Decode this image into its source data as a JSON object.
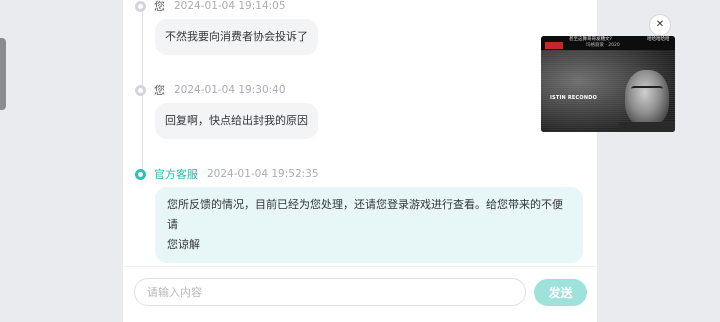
{
  "messages": [
    {
      "sender": "您",
      "time": "2024-01-04 19:14:05",
      "text": "不然我要向消费者协会投诉了"
    },
    {
      "sender": "您",
      "time": "2024-01-04 19:30:40",
      "text": "回复啊，快点给出封我的原因"
    },
    {
      "sender": "官方客服",
      "time": "2024-01-04 19:52:35",
      "text": "您所反馈的情况，目前已经为您处理，还请您登录游戏进行查看。给您带来的不便请",
      "text_line2": "您谅解"
    }
  ],
  "input": {
    "placeholder": "请输入内容",
    "value": ""
  },
  "send_button": {
    "label": "发送"
  },
  "close_button": {
    "icon": "close-icon",
    "glyph": "✕"
  },
  "video_overlay": {
    "caption_top": "甚至这算哥哥发糟文?",
    "caption_year": "玛格丽爱 · 2020",
    "caption_right": "哈哈哈哈哈",
    "label": "ISTIN RECONDO"
  },
  "colors": {
    "accent": "#2ec2b6",
    "send_button_bg": "#9ee2dc",
    "service_bubble_bg": "#e7f6f7",
    "user_bubble_bg": "#f3f4f6"
  }
}
